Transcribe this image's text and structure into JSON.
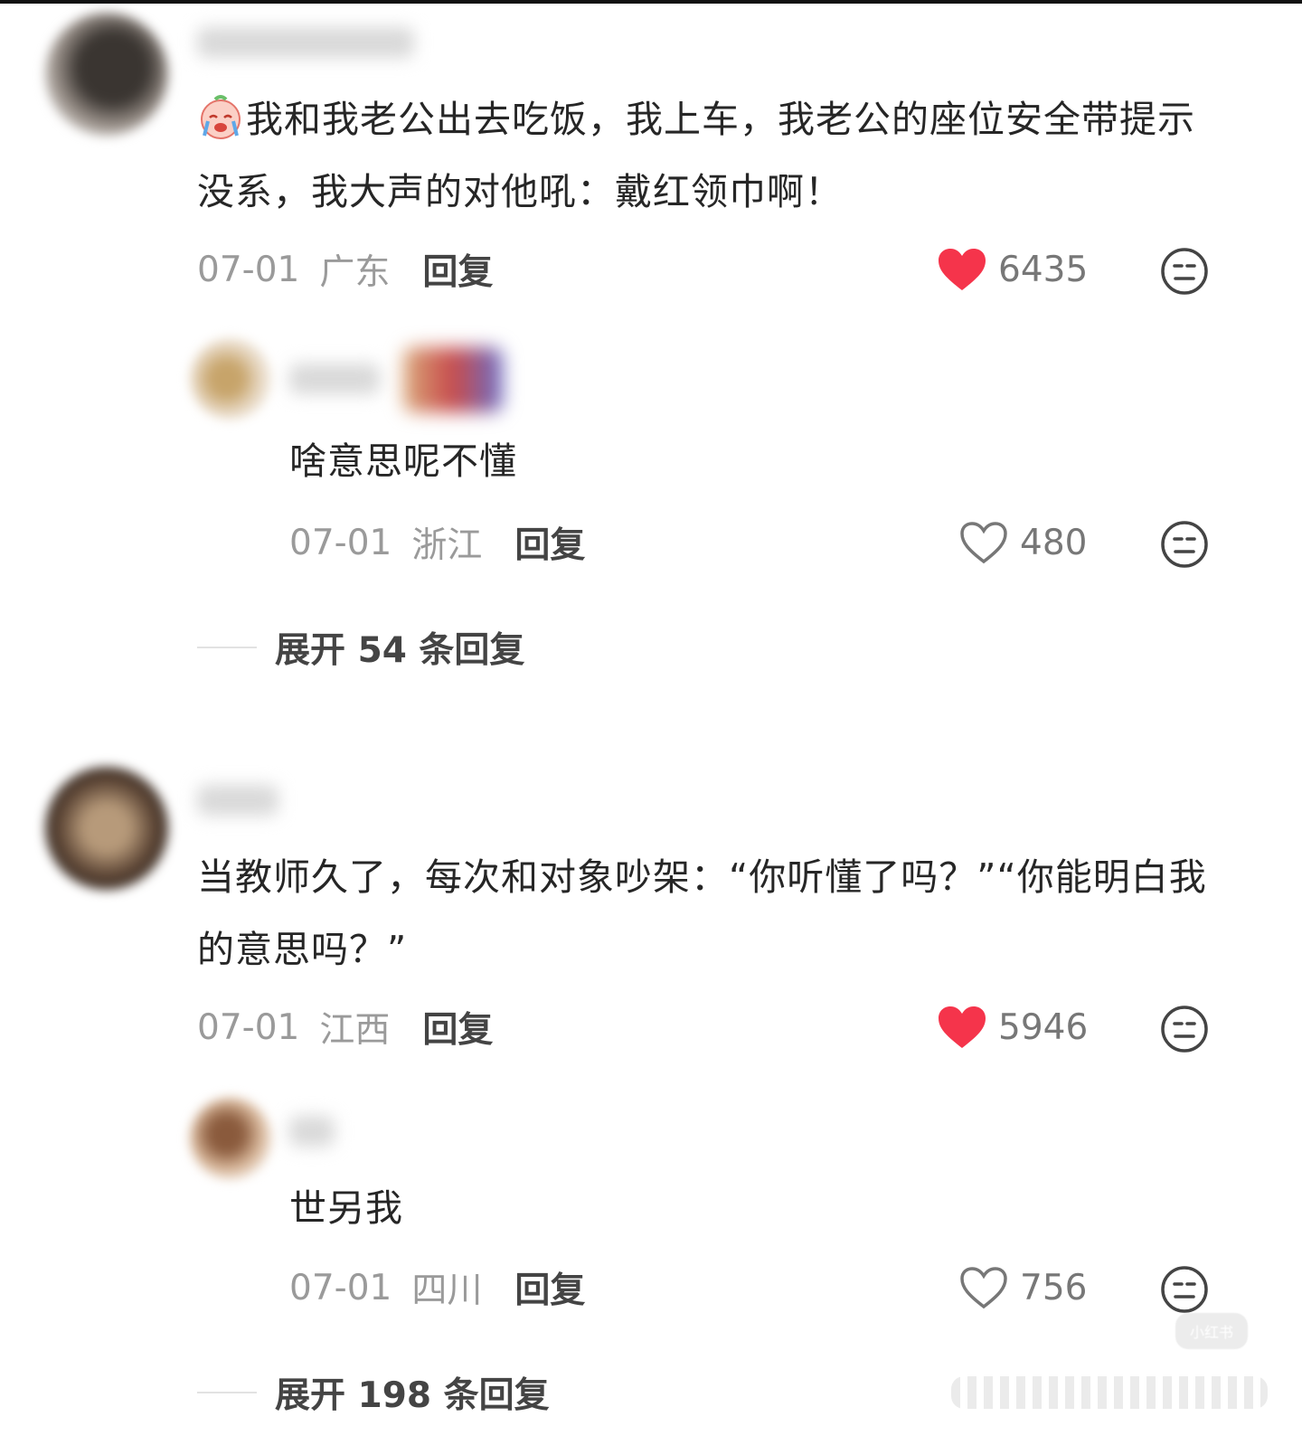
{
  "watermark": "小红书",
  "threads": [
    {
      "comment": {
        "text": "我和我老公出去吃饭，我上车，我老公的座位安全带提示没系，我大声的对他吼：戴红领巾啊！",
        "date": "07-01",
        "location": "广东",
        "reply_label": "回复",
        "likes": "6435",
        "liked": true
      },
      "reply": {
        "text": "啥意思呢不懂",
        "date": "07-01",
        "location": "浙江",
        "reply_label": "回复",
        "likes": "480",
        "liked": false
      },
      "expand_label": "展开 54 条回复"
    },
    {
      "comment": {
        "text": "当教师久了，每次和对象吵架：“你听懂了吗？”“你能明白我的意思吗？”",
        "date": "07-01",
        "location": "江西",
        "reply_label": "回复",
        "likes": "5946",
        "liked": true
      },
      "reply": {
        "text": "世另我",
        "date": "07-01",
        "location": "四川",
        "reply_label": "回复",
        "likes": "756",
        "liked": false
      },
      "expand_label": "展开 198 条回复"
    }
  ],
  "colors": {
    "heart_liked": "#f5344b",
    "heart_outline": "#777777",
    "meta_gray": "#9a9a9a",
    "text": "#262626"
  }
}
